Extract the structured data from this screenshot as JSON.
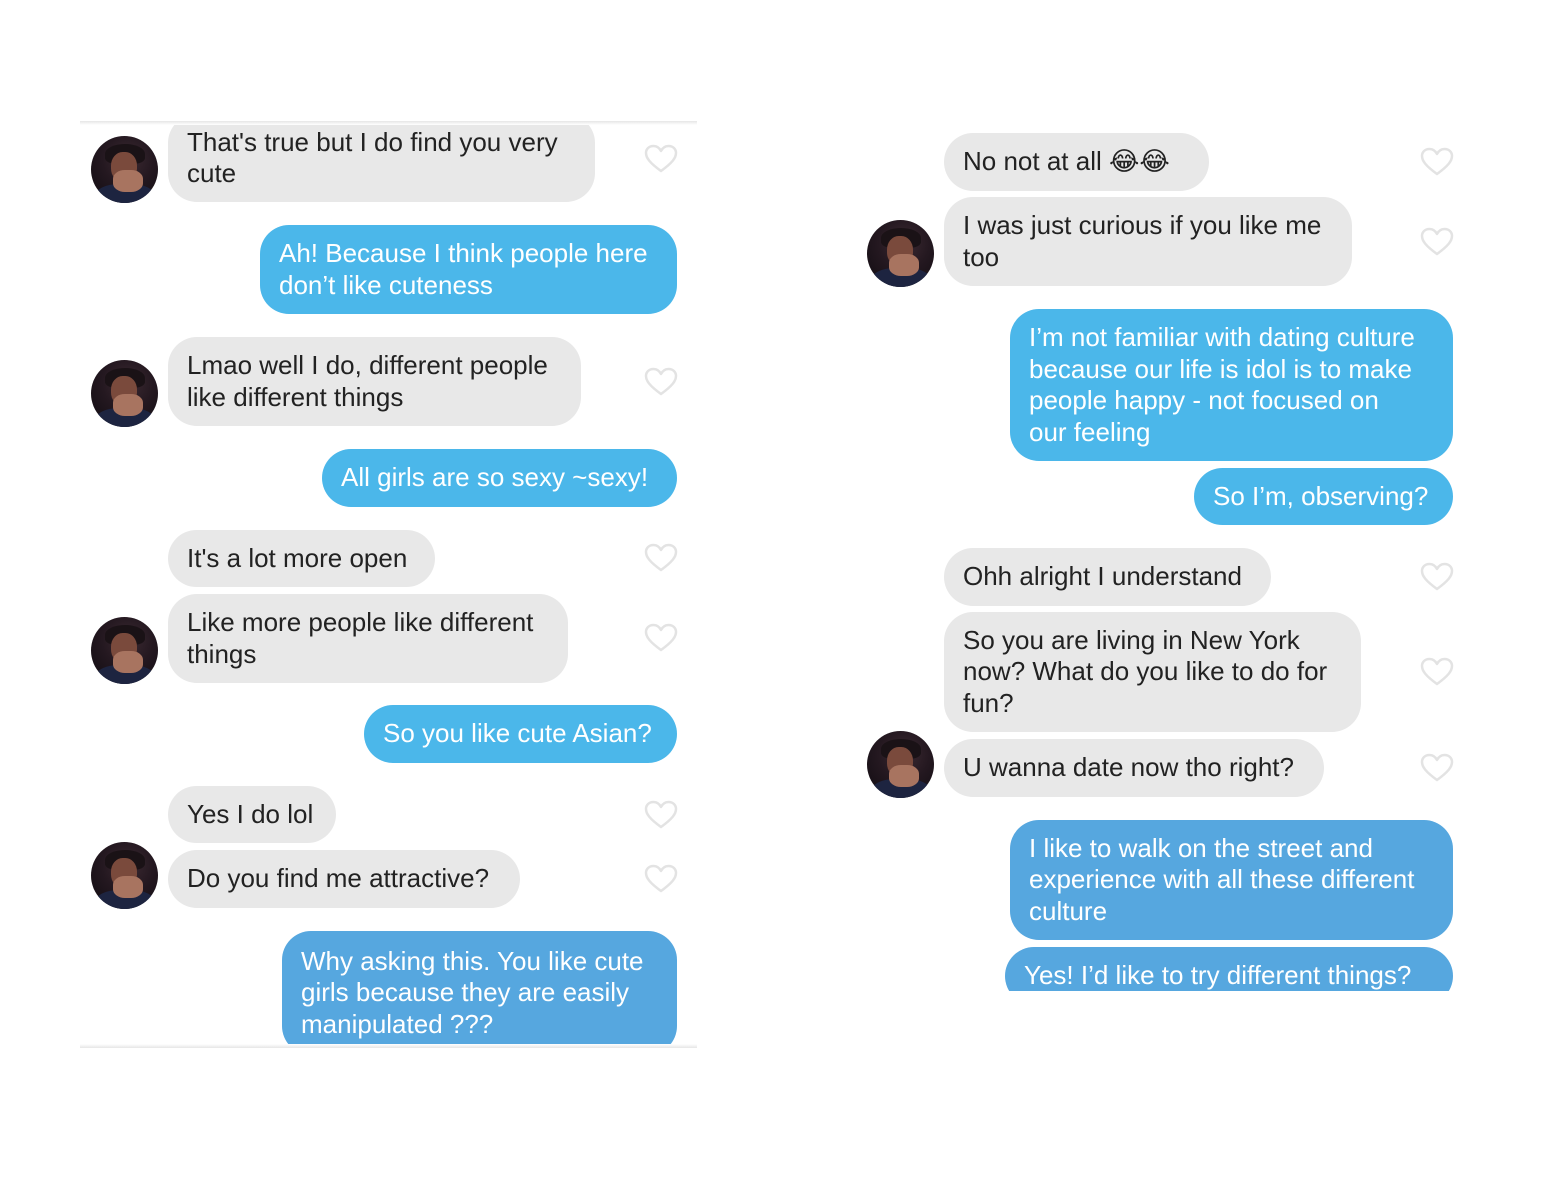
{
  "left": {
    "messages": [
      {
        "text": "That's true but I do find you very\ncute"
      },
      {
        "text": "Ah! Because I think people here\ndon’t like cuteness"
      },
      {
        "text": "Lmao well I do, different people\nlike different things"
      },
      {
        "text": "All girls are so sexy ~sexy!"
      },
      {
        "text": "It's a lot more open"
      },
      {
        "text": "Like more people like different\nthings"
      },
      {
        "text": "So you like cute Asian?"
      },
      {
        "text": "Yes I do lol"
      },
      {
        "text": "Do you find me attractive?"
      },
      {
        "text": "Why asking this. You like cute\ngirls because they are easily\nmanipulated ???"
      }
    ]
  },
  "right": {
    "messages": [
      {
        "text": "No not at all 😂😂"
      },
      {
        "text": "I was just curious if you like me\ntoo"
      },
      {
        "text": "I’m not familiar with dating culture\nbecause our life is idol is to make\npeople happy - not focused on\nour feeling"
      },
      {
        "text": "So I’m, observing?"
      },
      {
        "text": "Ohh alright I understand"
      },
      {
        "text": "So you are living in New York\nnow? What do you like to do for\nfun?"
      },
      {
        "text": "U wanna date now tho right?"
      },
      {
        "text": "I like to walk on the street and\nexperience with all these different\nculture"
      },
      {
        "text": "Yes! I’d like to try different things?"
      }
    ]
  },
  "colors": {
    "incoming_bubble": "#e8e8e8",
    "outgoing_bubble_light": "#4bb7ea",
    "outgoing_bubble_dark": "#56a7df",
    "heart_outline": "#e3e3e3"
  },
  "icons": {
    "like": "heart-outline-icon",
    "avatar": "user-avatar-photo"
  }
}
